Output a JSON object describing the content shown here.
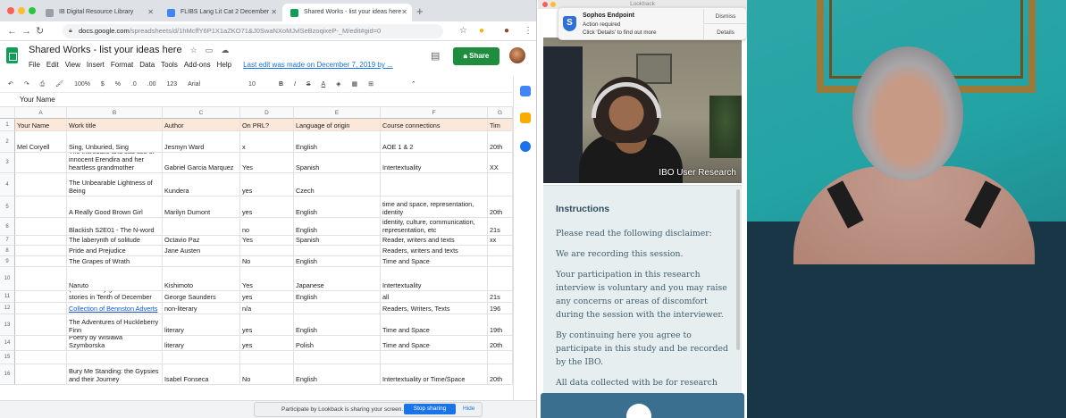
{
  "browser": {
    "tabs": [
      {
        "label": "IB Digital Resource Library",
        "favicon_color": "#9aa0a6"
      },
      {
        "label": "FLIBS Lang Lit Cat 2 December",
        "favicon_color": "#4285f4"
      },
      {
        "label": "Shared Works - list your ideas here",
        "favicon_color": "#0f9d58"
      }
    ],
    "url_host": "docs.google.com",
    "url_rest": "/spreadsheets/d/1hMcffY6P1X1aZKO71&J0SwaNXoMJvlSeBzoqixeP-_M/edit#gid=0"
  },
  "sheet": {
    "title": "Shared Works - list your ideas here",
    "menus": [
      "File",
      "Edit",
      "View",
      "Insert",
      "Format",
      "Data",
      "Tools",
      "Add-ons",
      "Help"
    ],
    "last_edit": "Last edit was made on December 7, 2019 by ...",
    "share_label": "Share",
    "toolbar": {
      "zoom": "100%",
      "currency": "$",
      "percent": "%",
      "dec0": ".0",
      "dec00": ".00",
      "fmt": "123",
      "font": "Arial",
      "size": "10",
      "bold": "B",
      "italic": "I",
      "strike": "S",
      "textcolor": "A"
    },
    "formula_bar": "Your Name",
    "columns": [
      "A",
      "B",
      "C",
      "D",
      "E",
      "F",
      "G"
    ],
    "header": [
      "Your Name",
      "Work title",
      "Author",
      "On PRL?",
      "Language of origin",
      "Course connections",
      "Tim"
    ],
    "rows": [
      {
        "n": "2",
        "cells": [
          "Mel Coryell",
          "Sing, Unburied, Sing",
          "Jesmyn Ward",
          "x",
          "English",
          "AOE 1 & 2",
          "20th"
        ]
      },
      {
        "n": "3",
        "cells": [
          "",
          "The incredible and sad tale of innocent Erendira and her heartless grandmother",
          "Gabriel Garcia Marquez",
          "Yes",
          "Spanish",
          "Intertextuality",
          "XX"
        ]
      },
      {
        "n": "4",
        "cells": [
          "",
          "The Unbearable Lightness of Being",
          "Kundera",
          "yes",
          "Czech",
          "",
          ""
        ]
      },
      {
        "n": "5",
        "cells": [
          "",
          "A Really Good Brown Girl",
          "Marilyn Dumont",
          "yes",
          "English",
          "time and space, representation, identity",
          "20th"
        ]
      },
      {
        "n": "6",
        "cells": [
          "",
          "Blackish S2E01 - The N-word",
          "",
          "no",
          "English",
          "identity, culture, communication, representation, etc",
          "21s"
        ]
      },
      {
        "n": "7",
        "cells": [
          "",
          "The laberynth of solitude",
          "Octavio Paz",
          "Yes",
          "Spanish",
          "Reader,  writers and texts",
          "xx"
        ]
      },
      {
        "n": "8",
        "cells": [
          "",
          "Pride and Prejudice",
          "Jane Austen",
          "",
          "",
          "Readers, writers and texts",
          ""
        ]
      },
      {
        "n": "9",
        "cells": [
          "",
          "The Grapes of Wrath",
          "",
          "No",
          "English",
          "Time and Space",
          ""
        ]
      },
      {
        "n": "10",
        "cells": [
          "",
          "Naruto",
          "Kishimoto",
          "Yes",
          "Japanese",
          "Intertextuality",
          ""
        ]
      },
      {
        "n": "11",
        "cells": [
          "",
          "\"The Semplica Girl Diaries\" (one of many great short stories in Tenth of December",
          "George Saunders",
          "yes",
          "English",
          "all",
          "21s"
        ]
      },
      {
        "n": "12",
        "cells": [
          "",
          "Collection of Bennston Adverts",
          "non-literary",
          "n/a",
          "",
          "Readers, Writers, Texts",
          "196"
        ]
      },
      {
        "n": "13",
        "cells": [
          "",
          "The Adventures of Huckleberry Finn",
          "literary",
          "yes",
          "English",
          "Time and Space",
          "19th"
        ]
      },
      {
        "n": "14",
        "cells": [
          "",
          "Poetry by Wislawa Szymborska",
          "literary",
          "yes",
          "Polish",
          "Time and Space",
          "20th"
        ]
      },
      {
        "n": "15",
        "cells": [
          "",
          "",
          "",
          "",
          "",
          "",
          ""
        ]
      },
      {
        "n": "16",
        "cells": [
          "",
          "Bury Me Standing: the Gypsies and their Journey",
          "Isabel Fonseca",
          "No",
          "English",
          "Intertextuality or Time/Space",
          "20th"
        ]
      }
    ],
    "sharing_note": "Participate by Lookback is sharing your screen.",
    "stop_sharing": "Stop sharing",
    "hide": "Hide"
  },
  "lookback": {
    "window_title": "Lookback",
    "notification": {
      "app": "Sophos Endpoint",
      "line1": "Action required",
      "line2": "Click 'Details' to find out more",
      "dismiss": "Dismiss",
      "details": "Details"
    },
    "camera_label": "IBO User Research",
    "instructions_title": "Instructions",
    "paragraphs": [
      "Please read the following disclaimer:",
      "We are recording this session.",
      "Your participation in this research interview is voluntary and you may raise any concerns or areas of discomfort during the session with the interviewer.",
      "By continuing here you agree to participate in this study and be recorded by the IBO.",
      "All data collected with be for research"
    ]
  },
  "colors": {
    "sheets_green": "#0f9d58",
    "share_green": "#1e8e3e",
    "header_fill": "#fce8d8",
    "lookback_blue": "#3a6f8f",
    "instructions_bg": "#e7eef0"
  }
}
